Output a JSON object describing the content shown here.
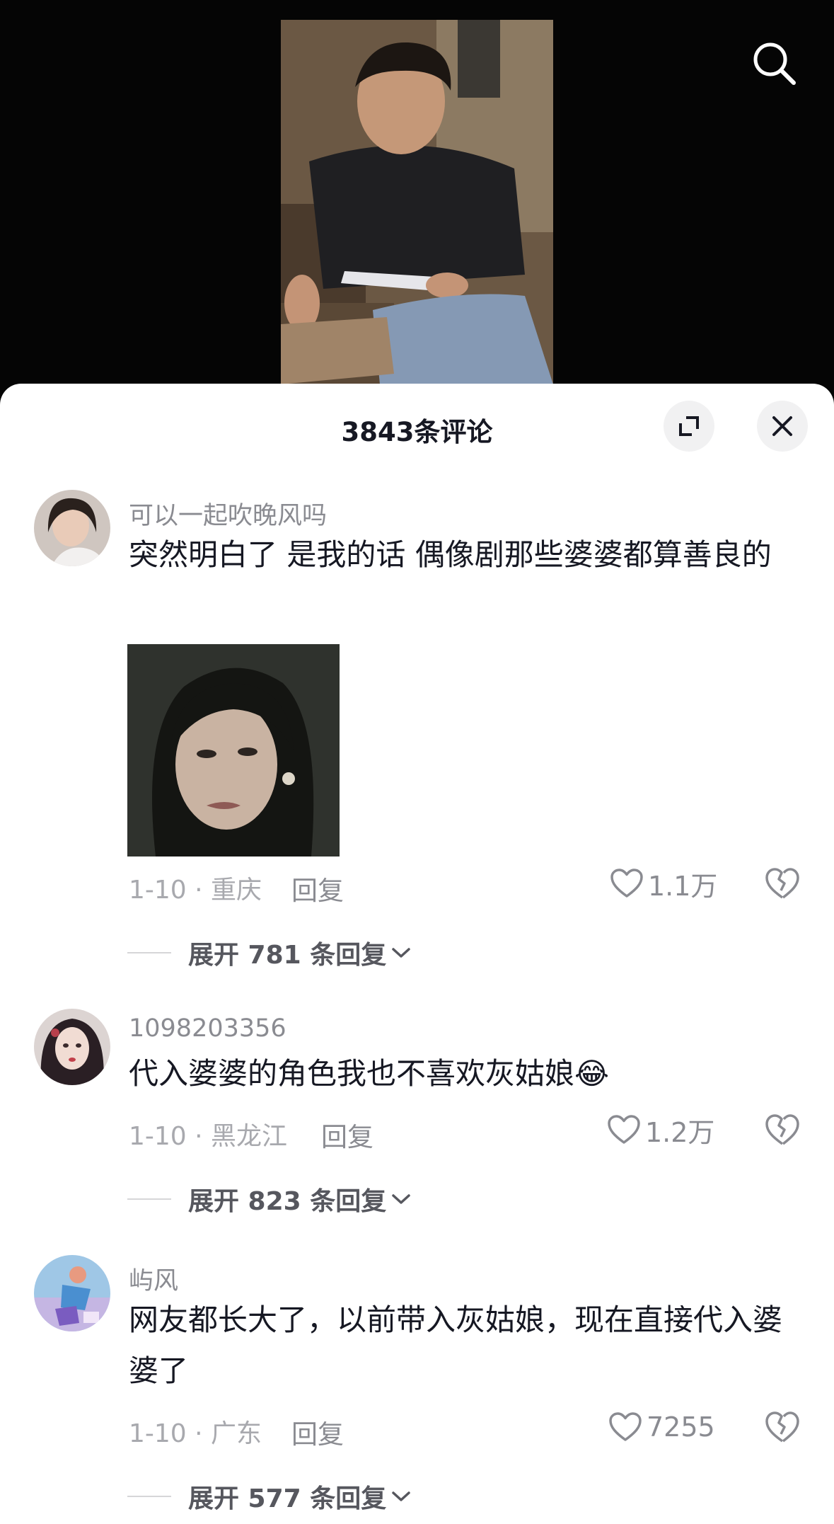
{
  "header": {
    "comment_count": "3843条评论"
  },
  "icons": {
    "search": "search-icon",
    "expand": "expand-icon",
    "close": "close-icon",
    "heart": "heart-icon",
    "dislike": "broken-heart-icon",
    "chevron": "chevron-down-icon"
  },
  "comments": [
    {
      "username": "可以一起吹晚风吗",
      "text": "突然明白了 是我的话 偶像剧那些婆婆都算善良的",
      "meta": "1-10 · 重庆",
      "reply_label": "回复",
      "likes": "1.1万",
      "expand_label": "展开 781 条回复"
    },
    {
      "username": "1098203356",
      "text": "代入婆婆的角色我也不喜欢灰姑娘",
      "emoji": "😂",
      "meta": "1-10 · 黑龙江",
      "reply_label": "回复",
      "likes": "1.2万",
      "expand_label": "展开 823 条回复"
    },
    {
      "username": "屿风",
      "text": "网友都长大了，以前带入灰姑娘，现在直接代入婆婆了",
      "meta": "1-10 · 广东",
      "reply_label": "回复",
      "likes": "7255",
      "expand_label": "展开 577 条回复"
    }
  ],
  "colors": {
    "text_primary": "#161823",
    "text_secondary": "#8a8b91",
    "sheet_background": "#ffffff",
    "video_background": "#000000"
  }
}
